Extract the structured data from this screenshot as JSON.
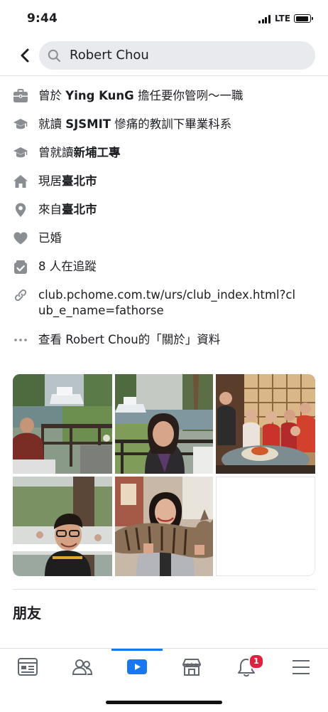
{
  "status_bar": {
    "time": "9:44",
    "network": "LTE"
  },
  "search": {
    "query": "Robert Chou",
    "icon": "search-icon"
  },
  "about": {
    "work": {
      "prefix": "曾於 ",
      "employer": "Ying KunG",
      "middle": " 擔任",
      "title": "要你管咧～",
      "suffix": "一職"
    },
    "education": {
      "prefix": "就讀 ",
      "school": "SJSMIT",
      "middle": " 慘痛的教訓下畢業",
      "suffix": "科系"
    },
    "past_education": {
      "prefix": "曾就讀",
      "school": "新埔工專"
    },
    "current_city": {
      "prefix": "現居",
      "city": "臺北市"
    },
    "hometown": {
      "prefix": "來自",
      "city": "臺北市"
    },
    "relationship": "已婚",
    "followers": "8 人在追蹤",
    "website": "club.pchome.com.tw/urs/club_index.html?club_e_name=fathorse",
    "see_about": "查看 Robert Chou的「關於」資料"
  },
  "sections": {
    "friends_title": "朋友"
  },
  "photos": [
    {
      "name": "photo-man-on-deck"
    },
    {
      "name": "photo-woman-by-lake"
    },
    {
      "name": "photo-family-dinner"
    },
    {
      "name": "photo-boy-smiling"
    },
    {
      "name": "photo-woman-with-cat"
    }
  ],
  "tab_bar": {
    "tabs": [
      "feed-icon",
      "friends-icon",
      "watch-icon",
      "marketplace-icon",
      "notifications-icon",
      "menu-icon"
    ],
    "active_tab": "watch-icon",
    "notification_count": "1",
    "accent_color": "#1877f2",
    "badge_color": "#e41e3f"
  }
}
